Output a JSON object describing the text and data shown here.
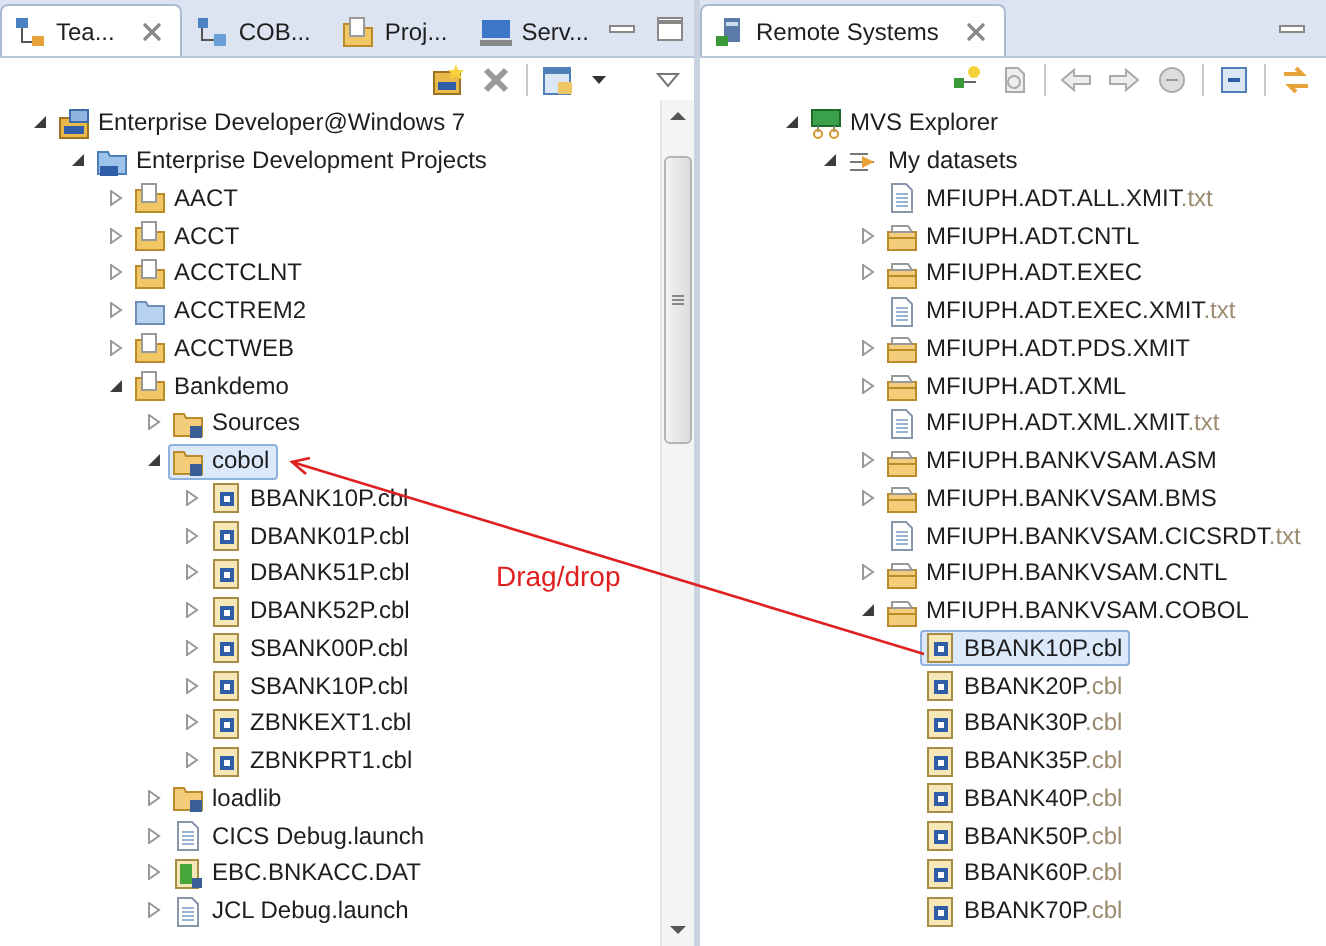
{
  "left_panel": {
    "tabs": [
      {
        "label": "Tea...",
        "kind": "team",
        "selected": true,
        "closable": true
      },
      {
        "label": "COB...",
        "kind": "cobol",
        "selected": false,
        "closable": false
      },
      {
        "label": "Proj...",
        "kind": "project",
        "selected": false,
        "closable": false
      },
      {
        "label": "Serv...",
        "kind": "server",
        "selected": false,
        "closable": false
      }
    ],
    "tree": [
      {
        "label": "Enterprise Developer@Windows 7",
        "kind": "system",
        "expanded": true,
        "selected": false,
        "children": [
          {
            "label": "Enterprise Development Projects",
            "kind": "projects",
            "expanded": true,
            "selected": false,
            "children": [
              {
                "label": "AACT",
                "kind": "project",
                "expanded": false,
                "selected": false
              },
              {
                "label": "ACCT",
                "kind": "project",
                "expanded": false,
                "selected": false
              },
              {
                "label": "ACCTCLNT",
                "kind": "project",
                "expanded": false,
                "selected": false
              },
              {
                "label": "ACCTREM2",
                "kind": "remote-project",
                "expanded": false,
                "selected": false
              },
              {
                "label": "ACCTWEB",
                "kind": "project",
                "expanded": false,
                "selected": false
              },
              {
                "label": "Bankdemo",
                "kind": "project",
                "expanded": true,
                "selected": false,
                "children": [
                  {
                    "label": "Sources",
                    "kind": "source-folder",
                    "expanded": false,
                    "selected": false
                  },
                  {
                    "label": "cobol",
                    "kind": "source-folder",
                    "expanded": true,
                    "selected": true,
                    "children": [
                      {
                        "label": "BBANK10P.cbl",
                        "kind": "cobol-file",
                        "expanded": false,
                        "selected": false
                      },
                      {
                        "label": "DBANK01P.cbl",
                        "kind": "cobol-file",
                        "expanded": false,
                        "selected": false
                      },
                      {
                        "label": "DBANK51P.cbl",
                        "kind": "cobol-file",
                        "expanded": false,
                        "selected": false
                      },
                      {
                        "label": "DBANK52P.cbl",
                        "kind": "cobol-file",
                        "expanded": false,
                        "selected": false
                      },
                      {
                        "label": "SBANK00P.cbl",
                        "kind": "cobol-file",
                        "expanded": false,
                        "selected": false
                      },
                      {
                        "label": "SBANK10P.cbl",
                        "kind": "cobol-file",
                        "expanded": false,
                        "selected": false
                      },
                      {
                        "label": "ZBNKEXT1.cbl",
                        "kind": "cobol-file",
                        "expanded": false,
                        "selected": false
                      },
                      {
                        "label": "ZBNKPRT1.cbl",
                        "kind": "cobol-file",
                        "expanded": false,
                        "selected": false
                      }
                    ]
                  },
                  {
                    "label": "loadlib",
                    "kind": "source-folder",
                    "expanded": false,
                    "selected": false
                  },
                  {
                    "label": "CICS Debug.launch",
                    "kind": "text-file",
                    "expanded": false,
                    "selected": false
                  },
                  {
                    "label": "EBC.BNKACC.DAT",
                    "kind": "data-file",
                    "expanded": false,
                    "selected": false
                  },
                  {
                    "label": "JCL Debug.launch",
                    "kind": "text-file",
                    "expanded": false,
                    "selected": false
                  }
                ]
              }
            ]
          }
        ]
      }
    ]
  },
  "right_panel": {
    "tabs": [
      {
        "label": "Remote Systems",
        "kind": "remote",
        "selected": true,
        "closable": true
      }
    ],
    "tree": [
      {
        "label": "MVS Explorer",
        "kind": "mvs",
        "expanded": true,
        "selected": false,
        "children": [
          {
            "label": "My datasets",
            "kind": "datasets",
            "expanded": true,
            "selected": false,
            "children": [
              {
                "label": "MFIUPH.ADT.ALL.XMIT",
                "extension": ".txt",
                "kind": "text-file",
                "selected": false
              },
              {
                "label": "MFIUPH.ADT.CNTL",
                "kind": "dataset",
                "expanded": false,
                "selected": false
              },
              {
                "label": "MFIUPH.ADT.EXEC",
                "kind": "dataset",
                "expanded": false,
                "selected": false
              },
              {
                "label": "MFIUPH.ADT.EXEC.XMIT",
                "extension": ".txt",
                "kind": "text-file",
                "selected": false
              },
              {
                "label": "MFIUPH.ADT.PDS.XMIT",
                "kind": "dataset",
                "expanded": false,
                "selected": false
              },
              {
                "label": "MFIUPH.ADT.XML",
                "kind": "dataset",
                "expanded": false,
                "selected": false
              },
              {
                "label": "MFIUPH.ADT.XML.XMIT",
                "extension": ".txt",
                "kind": "text-file",
                "selected": false
              },
              {
                "label": "MFIUPH.BANKVSAM.ASM",
                "kind": "dataset",
                "expanded": false,
                "selected": false
              },
              {
                "label": "MFIUPH.BANKVSAM.BMS",
                "kind": "dataset",
                "expanded": false,
                "selected": false
              },
              {
                "label": "MFIUPH.BANKVSAM.CICSRDT",
                "extension": ".txt",
                "kind": "text-file",
                "selected": false
              },
              {
                "label": "MFIUPH.BANKVSAM.CNTL",
                "kind": "dataset",
                "expanded": false,
                "selected": false
              },
              {
                "label": "MFIUPH.BANKVSAM.COBOL",
                "kind": "dataset",
                "expanded": true,
                "selected": false,
                "children": [
                  {
                    "label": "BBANK10P",
                    "extension": ".cbl",
                    "kind": "cobol-file",
                    "selected": true
                  },
                  {
                    "label": "BBANK20P",
                    "extension": ".cbl",
                    "kind": "cobol-file",
                    "selected": false
                  },
                  {
                    "label": "BBANK30P",
                    "extension": ".cbl",
                    "kind": "cobol-file",
                    "selected": false
                  },
                  {
                    "label": "BBANK35P",
                    "extension": ".cbl",
                    "kind": "cobol-file",
                    "selected": false
                  },
                  {
                    "label": "BBANK40P",
                    "extension": ".cbl",
                    "kind": "cobol-file",
                    "selected": false
                  },
                  {
                    "label": "BBANK50P",
                    "extension": ".cbl",
                    "kind": "cobol-file",
                    "selected": false
                  },
                  {
                    "label": "BBANK60P",
                    "extension": ".cbl",
                    "kind": "cobol-file",
                    "selected": false
                  },
                  {
                    "label": "BBANK70P",
                    "extension": ".cbl",
                    "kind": "cobol-file",
                    "selected": false
                  }
                ]
              }
            ]
          }
        ]
      }
    ]
  },
  "annotation": {
    "label": "Drag/drop"
  }
}
